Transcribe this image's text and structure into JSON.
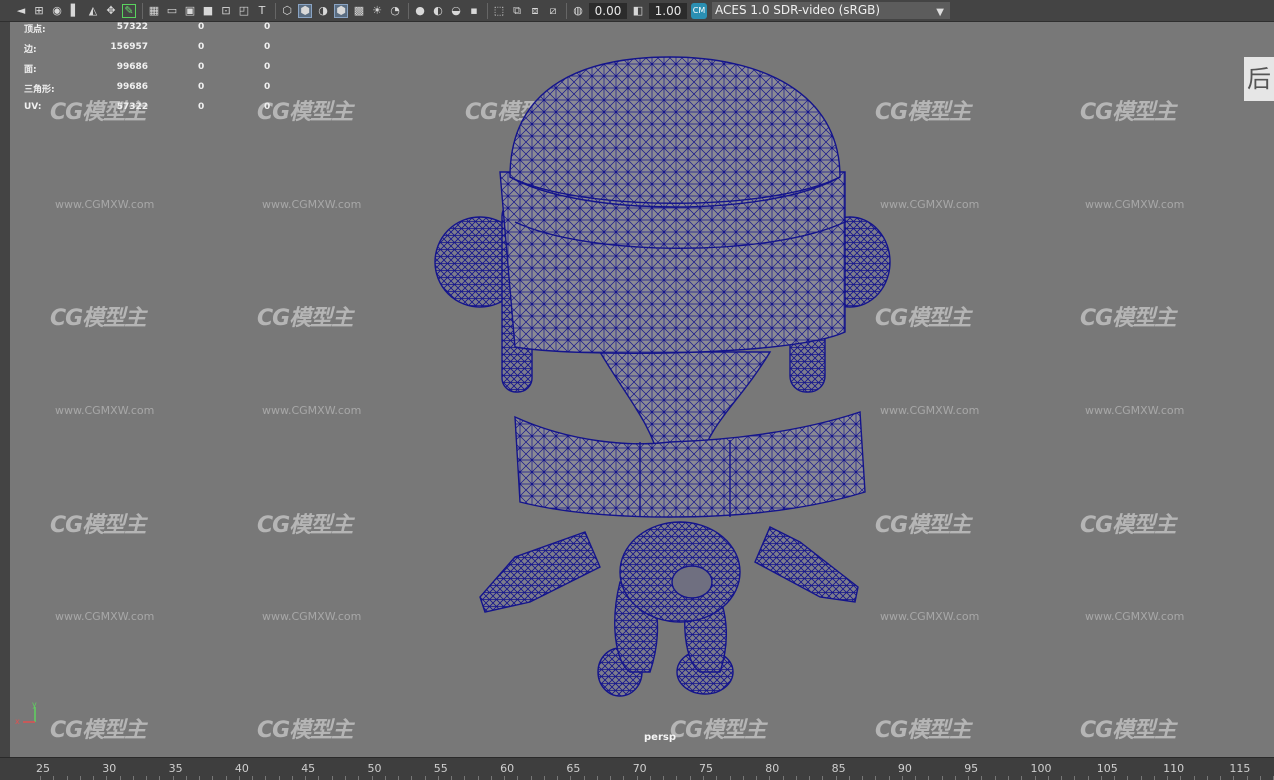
{
  "toolbar": {
    "exposure_value": "0.00",
    "gamma_value": "1.00",
    "color_management_badge": "CM",
    "view_transform": "ACES 1.0 SDR-video (sRGB)"
  },
  "hud": {
    "rows": [
      {
        "label": "顶点:",
        "v1": "57322",
        "v2": "0",
        "v3": "0"
      },
      {
        "label": "边:",
        "v1": "156957",
        "v2": "0",
        "v3": "0"
      },
      {
        "label": "面:",
        "v1": "99686",
        "v2": "0",
        "v3": "0"
      },
      {
        "label": "三角形:",
        "v1": "99686",
        "v2": "0",
        "v3": "0"
      },
      {
        "label": "UV:",
        "v1": "57322",
        "v2": "0",
        "v3": "0"
      }
    ]
  },
  "side_tab_text": "后",
  "camera_label": "persp",
  "axis": {
    "x": "x",
    "y": "y"
  },
  "watermark": {
    "logo": "CG模型主",
    "url": "www.CGMXW.com"
  },
  "timeline": {
    "ticks": [
      "25",
      "30",
      "35",
      "40",
      "45",
      "50",
      "55",
      "60",
      "65",
      "70",
      "75",
      "80",
      "85",
      "90",
      "95",
      "100",
      "105",
      "110",
      "115"
    ]
  },
  "colors": {
    "viewport_bg": "#787878",
    "wireframe": "#14148c",
    "toolbar_bg": "#444444",
    "cm_badge": "#2b8fb2"
  }
}
